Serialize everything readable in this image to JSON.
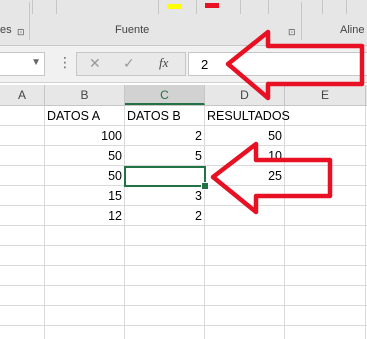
{
  "ribbon": {
    "groups": [
      "es",
      "Fuente",
      "Aline"
    ],
    "launcher_glyph": "⊡"
  },
  "namebox": {
    "value": ""
  },
  "formula_bar": {
    "cancel_glyph": "✕",
    "enter_glyph": "✓",
    "fx_glyph": "fx",
    "value": "2"
  },
  "columns": [
    "A",
    "B",
    "C",
    "D",
    "E"
  ],
  "selected_column": "C",
  "cells": {
    "headers": [
      "DATOS A",
      "DATOS B",
      "RESULTADOS"
    ],
    "rows": [
      {
        "a": "100",
        "b": "2",
        "r": "50"
      },
      {
        "a": "50",
        "b": "5",
        "r": "10"
      },
      {
        "a": "50",
        "b": "",
        "r": "25"
      },
      {
        "a": "15",
        "b": "3",
        "r": ""
      },
      {
        "a": "12",
        "b": "2",
        "r": ""
      }
    ]
  },
  "colors": {
    "accent": "#217346",
    "annotation": "#e81123"
  },
  "icons": [
    "cancel-icon",
    "enter-icon",
    "function-icon",
    "dropdown-icon",
    "launcher-icon",
    "arrow-annotation"
  ]
}
